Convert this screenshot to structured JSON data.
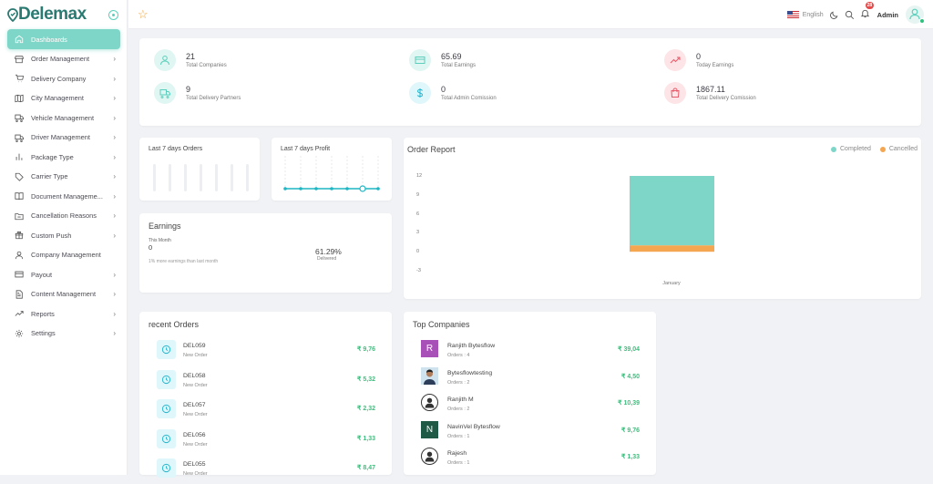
{
  "app": {
    "logo": "Delemax"
  },
  "sidebar": {
    "items": [
      {
        "label": "Dashboards",
        "icon": "home-icon",
        "active": true,
        "chevron": false
      },
      {
        "label": "Order Management",
        "icon": "store-icon",
        "chevron": true
      },
      {
        "label": "Delivery Company",
        "icon": "cart-icon",
        "chevron": true
      },
      {
        "label": "City Management",
        "icon": "map-icon",
        "chevron": true
      },
      {
        "label": "Vehicle Management",
        "icon": "truck-icon",
        "chevron": true
      },
      {
        "label": "Driver Management",
        "icon": "truck-icon",
        "chevron": true
      },
      {
        "label": "Package Type",
        "icon": "bar-chart-icon",
        "chevron": true
      },
      {
        "label": "Carrier Type",
        "icon": "tag-icon",
        "chevron": true
      },
      {
        "label": "Document Manageme...",
        "icon": "book-icon",
        "chevron": true
      },
      {
        "label": "Cancellation Reasons",
        "icon": "folder-icon",
        "chevron": true
      },
      {
        "label": "Custom Push",
        "icon": "gift-icon",
        "chevron": true
      },
      {
        "label": "Company Management",
        "icon": "user-icon",
        "chevron": false
      },
      {
        "label": "Payout",
        "icon": "credit-card-icon",
        "chevron": true
      },
      {
        "label": "Content Management",
        "icon": "document-icon",
        "chevron": true
      },
      {
        "label": "Reports",
        "icon": "trending-up-icon",
        "chevron": true
      },
      {
        "label": "Settings",
        "icon": "gear-icon",
        "chevron": true
      }
    ]
  },
  "topbar": {
    "language": "English",
    "notification_count": "28",
    "user": "Admin"
  },
  "stats": [
    {
      "value": "21",
      "label": "Total Companies",
      "icon": "user-icon",
      "color": "teal"
    },
    {
      "value": "65.69",
      "label": "Total Earnings",
      "icon": "credit-card-icon",
      "color": "teal"
    },
    {
      "value": "0",
      "label": "Today Earnings",
      "icon": "trending-up-icon",
      "color": "red"
    },
    {
      "value": "9",
      "label": "Total Delivery Partners",
      "icon": "truck-icon",
      "color": "teal"
    },
    {
      "value": "0",
      "label": "Total Admin Comission",
      "icon": "dollar-icon",
      "color": "cyan"
    },
    {
      "value": "1867.11",
      "label": "Total Delivery Comission",
      "icon": "shopping-bag-icon",
      "color": "red"
    }
  ],
  "orders_card": {
    "title": "Last 7 days Orders"
  },
  "profit_card": {
    "title": "Last 7 days Profit"
  },
  "earnings": {
    "title": "Earnings",
    "period": "This Month",
    "value": "0",
    "note": "1% more earnings than last month",
    "percent": "61.29%",
    "percent_label": "Delivered"
  },
  "order_report": {
    "title": "Order Report"
  },
  "chart_data": {
    "type": "bar",
    "categories": [
      "January"
    ],
    "series": [
      {
        "name": "Completed",
        "values": [
          11
        ],
        "color": "#7ed6c8"
      },
      {
        "name": "Cancelled",
        "values": [
          1
        ],
        "color": "#f5a650"
      }
    ],
    "stacked": true,
    "yticks": [
      "12",
      "9",
      "6",
      "3",
      "0",
      "-3"
    ],
    "ylim": [
      -3,
      12
    ],
    "legend": "top-right"
  },
  "recent_orders": {
    "title": "recent Orders",
    "items": [
      {
        "id": "DEL059",
        "status": "New Order",
        "amount": "₹ 9,76"
      },
      {
        "id": "DEL058",
        "status": "New Order",
        "amount": "₹ 5,32"
      },
      {
        "id": "DEL057",
        "status": "New Order",
        "amount": "₹ 2,32"
      },
      {
        "id": "DEL056",
        "status": "New Order",
        "amount": "₹ 1,33"
      },
      {
        "id": "DEL055",
        "status": "New Order",
        "amount": "₹ 8,47"
      }
    ]
  },
  "top_companies": {
    "title": "Top Companies",
    "items": [
      {
        "name": "Ranjith Bytesflow",
        "orders": "Orders : 4",
        "amount": "₹ 39,04",
        "avatar": "R",
        "avatar_color": "#a950b8"
      },
      {
        "name": "Bytesflowtesting",
        "orders": "Orders : 2",
        "amount": "₹ 4,50",
        "avatar": "",
        "avatar_color": "#e9c9a6"
      },
      {
        "name": "Ranjith M",
        "orders": "Orders : 2",
        "amount": "₹ 10,39",
        "avatar": "",
        "avatar_color": "#ffffff"
      },
      {
        "name": "NavinVel Bytesflow",
        "orders": "Orders : 1",
        "amount": "₹ 9,76",
        "avatar": "N",
        "avatar_color": "#1e5a46"
      },
      {
        "name": "Rajesh",
        "orders": "Orders : 1",
        "amount": "₹ 1,33",
        "avatar": "",
        "avatar_color": "#ffffff"
      }
    ]
  }
}
